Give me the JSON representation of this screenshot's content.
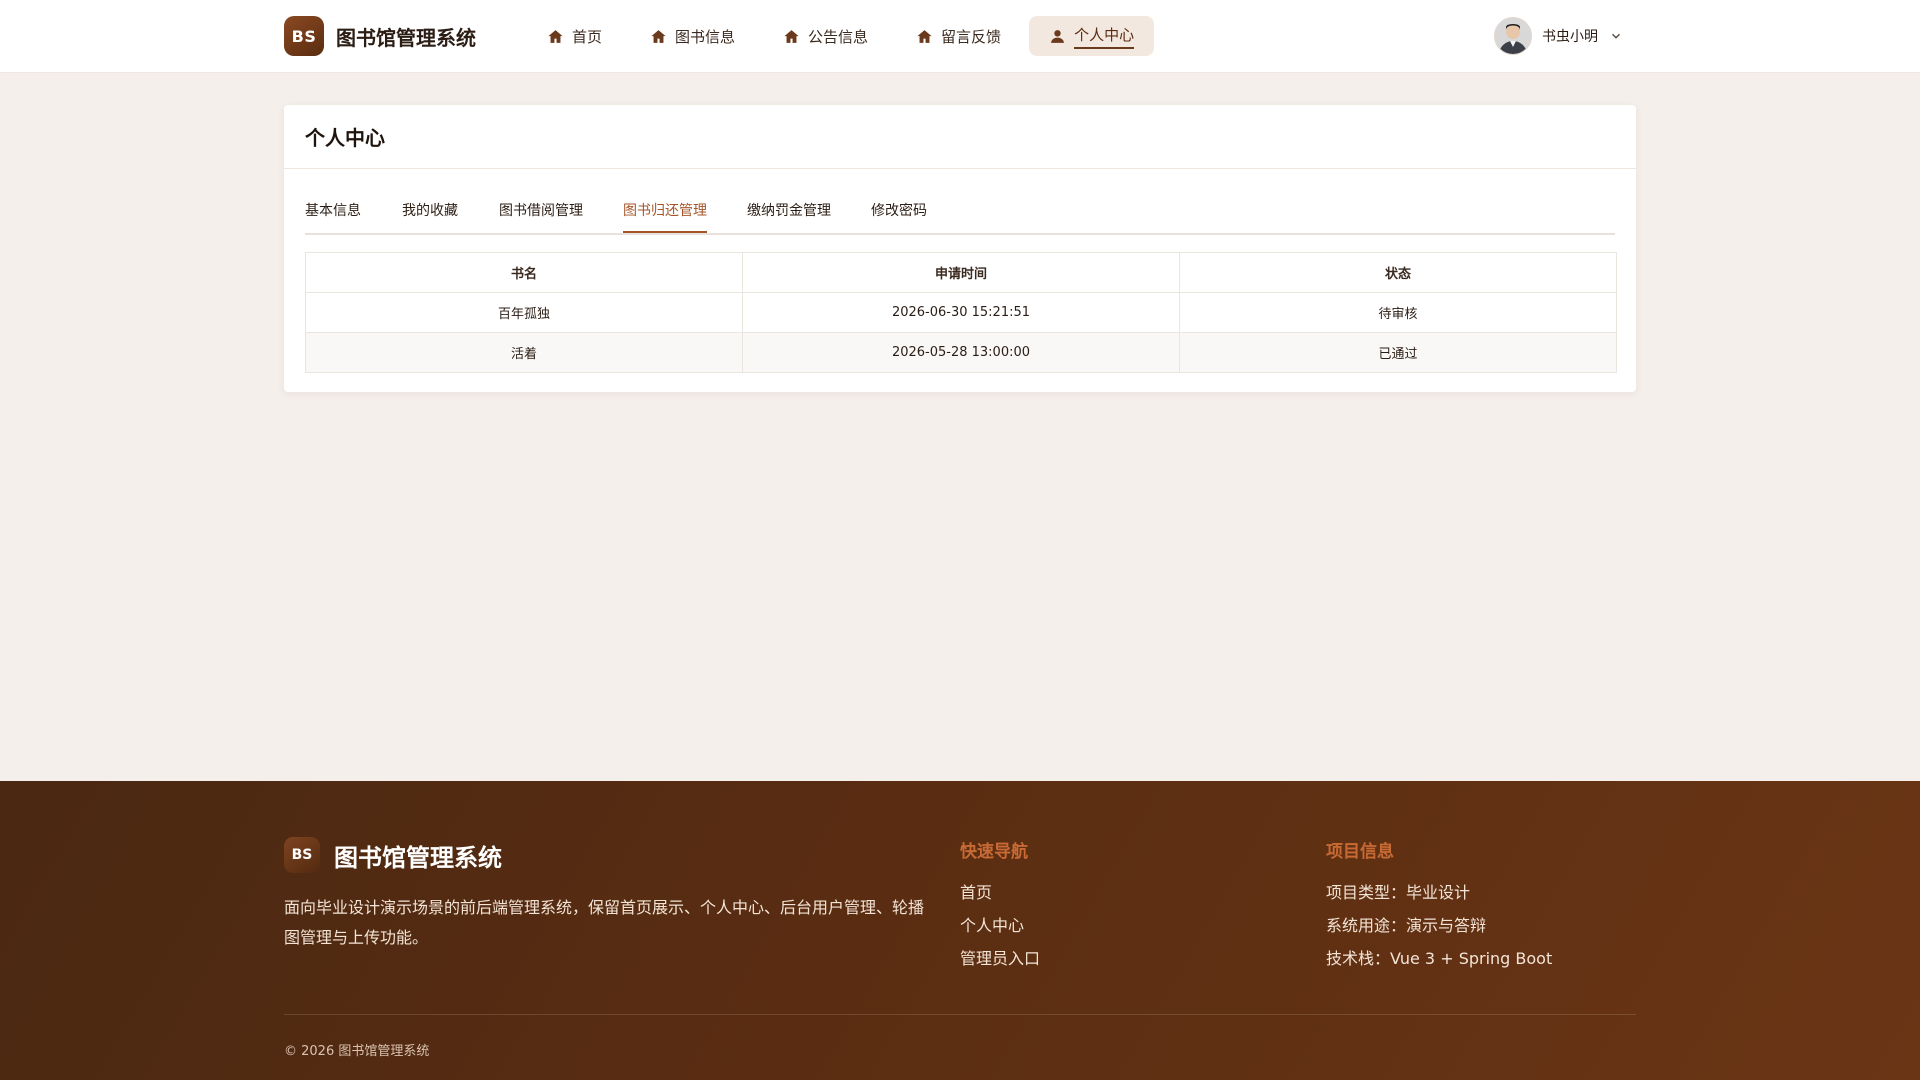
{
  "brand": {
    "logo_text": "BS",
    "name": "图书馆管理系统"
  },
  "nav": {
    "items": [
      {
        "label": "首页",
        "icon": "home-icon"
      },
      {
        "label": "图书信息",
        "icon": "home-icon"
      },
      {
        "label": "公告信息",
        "icon": "home-icon"
      },
      {
        "label": "留言反馈",
        "icon": "home-icon"
      },
      {
        "label": "个人中心",
        "icon": "user-icon",
        "active": true
      }
    ]
  },
  "user": {
    "name": "书虫小明",
    "avatar": "avatar-image",
    "dropdown_icon": "chevron-down-icon"
  },
  "page": {
    "title": "个人中心"
  },
  "tabs": [
    {
      "label": "基本信息"
    },
    {
      "label": "我的收藏"
    },
    {
      "label": "图书借阅管理"
    },
    {
      "label": "图书归还管理",
      "active": true
    },
    {
      "label": "缴纳罚金管理"
    },
    {
      "label": "修改密码"
    }
  ],
  "table": {
    "headers": [
      "书名",
      "申请时间",
      "状态"
    ],
    "rows": [
      [
        "百年孤独",
        "2026-06-30 15:21:51",
        "待审核"
      ],
      [
        "活着",
        "2026-05-28 13:00:00",
        "已通过"
      ]
    ]
  },
  "footer": {
    "logo_text": "BS",
    "brand_name": "图书馆管理系统",
    "description": "面向毕业设计演示场景的前后端管理系统，保留首页展示、个人中心、后台用户管理、轮播图管理与上传功能。",
    "quick_nav": {
      "title": "快速导航",
      "links": [
        "首页",
        "个人中心",
        "管理员入口"
      ]
    },
    "project_info": {
      "title": "项目信息",
      "items": [
        "项目类型：毕业设计",
        "系统用途：演示与答辩",
        "技术栈：Vue 3 + Spring Boot"
      ]
    },
    "copyright": "© 2026 图书馆管理系统"
  },
  "colors": {
    "accent": "#a5552a",
    "brand_dark": "#5a2c10",
    "page_bg": "#f4efeb",
    "footer_title": "#c86a34"
  }
}
